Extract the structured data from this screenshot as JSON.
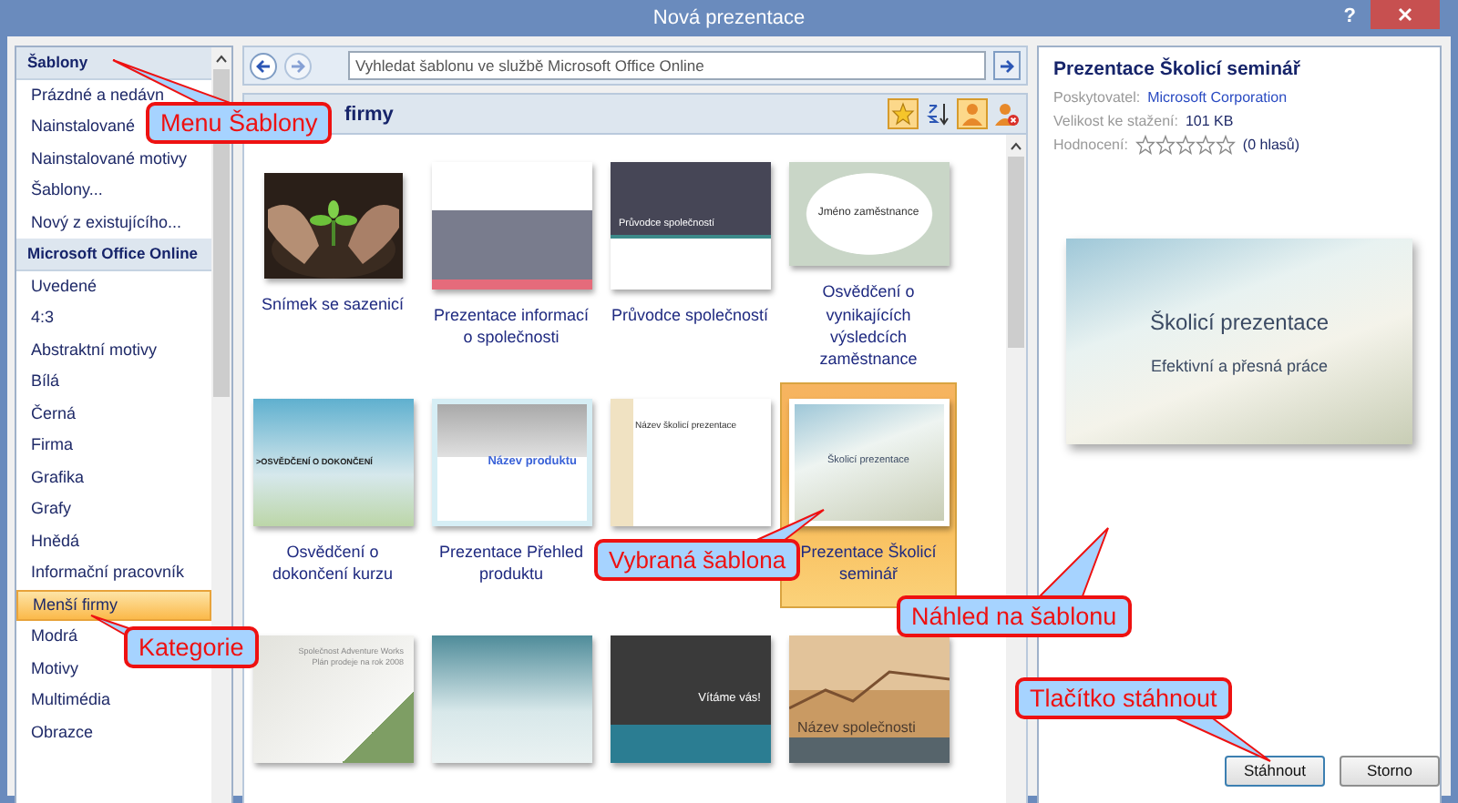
{
  "window": {
    "title": "Nová prezentace",
    "help": "?"
  },
  "sidebar": {
    "items": [
      {
        "label": "Šablony",
        "kind": "header",
        "selected": false
      },
      {
        "label": "Prázdné a nedávn",
        "kind": "item",
        "selected": false
      },
      {
        "label": "Nainstalované",
        "kind": "item",
        "selected": false
      },
      {
        "label": "Nainstalované motivy",
        "kind": "item",
        "selected": false
      },
      {
        "label": "Šablony...",
        "kind": "item",
        "selected": false
      },
      {
        "label": "Nový z existujícího...",
        "kind": "item",
        "selected": false
      },
      {
        "label": "Microsoft Office Online",
        "kind": "header",
        "selected": false
      },
      {
        "label": "Uvedené",
        "kind": "item",
        "selected": false
      },
      {
        "label": "4:3",
        "kind": "item",
        "selected": false
      },
      {
        "label": "Abstraktní motivy",
        "kind": "item",
        "selected": false
      },
      {
        "label": "Bílá",
        "kind": "item",
        "selected": false
      },
      {
        "label": "Černá",
        "kind": "item",
        "selected": false
      },
      {
        "label": "Firma",
        "kind": "item",
        "selected": false
      },
      {
        "label": "Grafika",
        "kind": "item",
        "selected": false
      },
      {
        "label": "Grafy",
        "kind": "item",
        "selected": false
      },
      {
        "label": "Hnědá",
        "kind": "item",
        "selected": false
      },
      {
        "label": "Informační pracovník",
        "kind": "item",
        "selected": false
      },
      {
        "label": "Menší firmy",
        "kind": "item",
        "selected": true
      },
      {
        "label": "Modrá",
        "kind": "item",
        "selected": false
      },
      {
        "label": "Motivy",
        "kind": "item",
        "selected": false
      },
      {
        "label": "Multimédia",
        "kind": "item",
        "selected": false
      },
      {
        "label": "Obrazce",
        "kind": "item",
        "selected": false
      }
    ]
  },
  "search": {
    "placeholder": "Vyhledat šablonu ve službě Microsoft Office Online"
  },
  "gallery": {
    "heading": "firmy",
    "view_buttons": [
      {
        "kind": "rating-sort",
        "selected": true
      },
      {
        "kind": "alpha-sort",
        "selected": false
      },
      {
        "kind": "person",
        "selected": true
      },
      {
        "kind": "person-remove",
        "selected": false
      }
    ],
    "templates": [
      {
        "name": "Snímek se sazenicí",
        "kind": "seedling",
        "selected": false
      },
      {
        "name": "Prezentace informací o společnosti",
        "kind": "company",
        "selected": false
      },
      {
        "name": "Průvodce společností",
        "kind": "guide",
        "selected": false,
        "texts": [
          "Průvodce společností"
        ]
      },
      {
        "name": "Osvědčení o vynikajících výsledcích zaměstnance",
        "kind": "certificate",
        "selected": false,
        "texts": [
          "Jméno zaměstnance"
        ]
      },
      {
        "name": "Osvědčení o dokončení kurzu",
        "kind": "completion",
        "selected": false,
        "texts": [
          ">OSVĚDČENÍ O DOKONČENÍ"
        ]
      },
      {
        "name": "Prezentace Přehled produktu",
        "kind": "product",
        "selected": false,
        "texts": [
          "Název produktu"
        ]
      },
      {
        "kind": "training-light",
        "selected": false,
        "texts": [
          "Název školicí prezentace"
        ]
      },
      {
        "name": "Prezentace Školicí seminář",
        "kind": "training",
        "selected": true,
        "texts": [
          "Školicí prezentace"
        ]
      },
      {
        "kind": "adventure",
        "selected": false,
        "texts": [
          "Společnost Adventure Works",
          "Plán prodeje na rok 2008"
        ]
      },
      {
        "kind": "proposal",
        "selected": false
      },
      {
        "kind": "welcome",
        "selected": false,
        "texts": [
          "Vítáme vás!"
        ]
      },
      {
        "kind": "finance",
        "selected": false,
        "texts": [
          "Název společnosti"
        ]
      }
    ]
  },
  "details": {
    "title": "Prezentace Školicí seminář",
    "fields": [
      {
        "label": "Poskytovatel:",
        "value": "Microsoft Corporation",
        "kind": "link"
      },
      {
        "label": "Velikost ke stažení:",
        "value": "101 KB",
        "kind": "text"
      },
      {
        "label": "Hodnocení:",
        "value": "(0 hlasů)",
        "kind": "rating",
        "stars": 0
      }
    ],
    "preview": {
      "title": "Školicí prezentace",
      "subtitle": "Efektivní a přesná práce"
    }
  },
  "buttons": [
    {
      "label": "Stáhnout",
      "default": true
    },
    {
      "label": "Storno",
      "default": false
    }
  ],
  "callouts": [
    {
      "text": "Menu Šablony"
    },
    {
      "text": "Kategorie"
    },
    {
      "text": "Vybraná šablona"
    },
    {
      "text": "Náhled na šablonu"
    },
    {
      "text": "Tlačítko stáhnout"
    }
  ]
}
